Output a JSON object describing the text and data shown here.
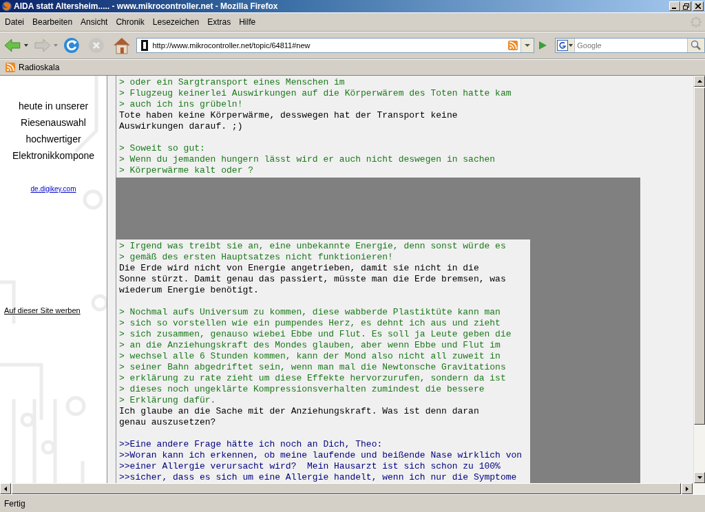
{
  "window": {
    "title": "AIDA statt Altersheim..... - www.mikrocontroller.net - Mozilla Firefox"
  },
  "menu": [
    "Datei",
    "Bearbeiten",
    "Ansicht",
    "Chronik",
    "Lesezeichen",
    "Extras",
    "Hilfe"
  ],
  "address_bar": {
    "url": "http://www.mikrocontroller.net/topic/64811#new"
  },
  "search": {
    "placeholder": "Google"
  },
  "bookmarks": [
    "Radioskala"
  ],
  "sidebar": {
    "ad_lines": [
      "heute in unserer",
      "Riesenauswahl",
      "hochwertiger",
      "Elektronikkompone"
    ],
    "ad_link": "de.digikey.com",
    "advertise_link": "Auf dieser Site werben"
  },
  "posts": [
    {
      "lines": [
        {
          "kind": "quote",
          "text": "> oder ein Sargtransport eines Menschen im"
        },
        {
          "kind": "quote",
          "text": "> Flugzeug keinerlei Auswirkungen auf die Körperwärem des Toten hatte kam"
        },
        {
          "kind": "quote",
          "text": "> auch ich ins grübeln!"
        },
        {
          "kind": "text",
          "text": "Tote haben keine Körperwärme, desswegen hat der Transport keine"
        },
        {
          "kind": "text",
          "text": "Auswirkungen darauf. ;)"
        },
        {
          "kind": "blank"
        },
        {
          "kind": "quote",
          "text": "> Soweit so gut:"
        },
        {
          "kind": "quote",
          "text": "> Wenn du jemanden hungern lässt wird er auch nicht deswegen in sachen"
        },
        {
          "kind": "quote",
          "text": "> Körperwärme kalt oder ?"
        }
      ]
    },
    {
      "lines": [
        {
          "kind": "quote",
          "text": "> Irgend was treibt sie an, eine unbekannte Energie, denn sonst würde es"
        },
        {
          "kind": "quote",
          "text": "> gemäß des ersten Hauptsatzes nicht funktionieren!"
        },
        {
          "kind": "text",
          "text": "Die Erde wird nicht von Energie angetrieben, damit sie nicht in die"
        },
        {
          "kind": "text",
          "text": "Sonne stürzt. Damit genau das passiert, müsste man die Erde bremsen, was"
        },
        {
          "kind": "text",
          "text": "wiederum Energie benötigt."
        },
        {
          "kind": "blank"
        },
        {
          "kind": "quote",
          "text": "> Nochmal aufs Universum zu kommen, diese wabberde Plastiktüte kann man"
        },
        {
          "kind": "quote",
          "text": "> sich so vorstellen wie ein pumpendes Herz, es dehnt ich aus und zieht"
        },
        {
          "kind": "quote",
          "text": "> sich zusammen, genauso wiebei Ebbe und Flut. Es soll ja Leute geben die"
        },
        {
          "kind": "quote",
          "text": "> an die Anziehungskraft des Mondes glauben, aber wenn Ebbe und Flut im"
        },
        {
          "kind": "quote",
          "text": "> wechsel alle 6 Stunden kommen, kann der Mond also nicht all zuweit in"
        },
        {
          "kind": "quote",
          "text": "> seiner Bahn abgedriftet sein, wenn man mal die Newtonsche Gravitations"
        },
        {
          "kind": "quote",
          "text": "> erklärung zu rate zieht um diese Effekte hervorzurufen, sondern da ist"
        },
        {
          "kind": "quote",
          "text": "> dieses noch ungeklärte Kompressionsverhalten zumindest die bessere"
        },
        {
          "kind": "quote",
          "text": "> Erklärung dafür."
        },
        {
          "kind": "text",
          "text": "Ich glaube an die Sache mit der Anziehungskraft. Was ist denn daran"
        },
        {
          "kind": "text",
          "text": "genau auszusetzen?"
        },
        {
          "kind": "blank"
        },
        {
          "kind": "deep_quote",
          "text": ">>Eine andere Frage hätte ich noch an Dich, Theo:"
        },
        {
          "kind": "deep_quote",
          "text": ">>Woran kann ich erkennen, ob meine laufende und beißende Nase wirklich von"
        },
        {
          "kind": "deep_quote",
          "text": ">>einer Allergie verursacht wird?  Mein Hausarzt ist sich schon zu 100%"
        },
        {
          "kind": "deep_quote",
          "text": ">>sicher, dass es sich um eine Allergie handelt, wenn ich nur die Symptome"
        }
      ]
    }
  ],
  "status_bar": {
    "text": "Fertig"
  }
}
